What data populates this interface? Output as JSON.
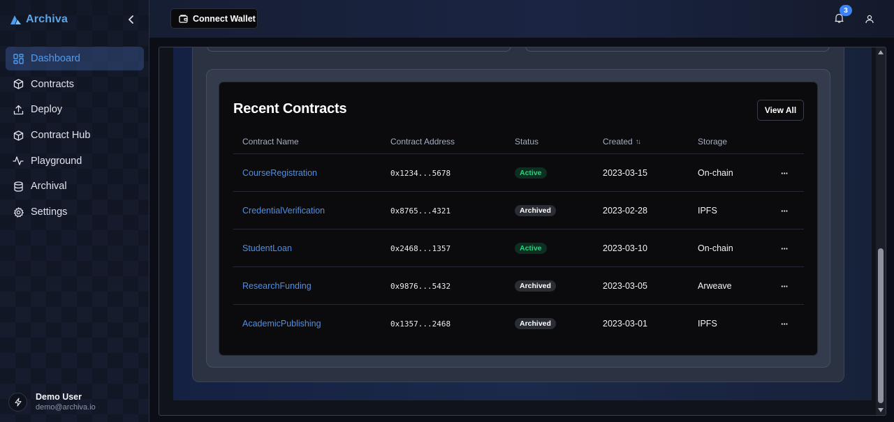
{
  "brand": {
    "name": "Archiva"
  },
  "sidebar": {
    "items": [
      {
        "label": "Dashboard",
        "icon": "dashboard-icon",
        "active": true
      },
      {
        "label": "Contracts",
        "icon": "cube-icon",
        "active": false
      },
      {
        "label": "Deploy",
        "icon": "upload-icon",
        "active": false
      },
      {
        "label": "Contract Hub",
        "icon": "cube-icon",
        "active": false
      },
      {
        "label": "Playground",
        "icon": "activity-icon",
        "active": false
      },
      {
        "label": "Archival",
        "icon": "database-icon",
        "active": false
      },
      {
        "label": "Settings",
        "icon": "gear-icon",
        "active": false
      }
    ],
    "user": {
      "name": "Demo User",
      "email": "demo@archiva.io"
    }
  },
  "topbar": {
    "connect_wallet_label": "Connect Wallet",
    "notification_count": "3"
  },
  "recent_contracts": {
    "title": "Recent Contracts",
    "view_all_label": "View All",
    "columns": [
      "Contract Name",
      "Contract Address",
      "Status",
      "Created",
      "Storage"
    ],
    "sort_indicator": "↑↓",
    "rows": [
      {
        "name": "CourseRegistration",
        "address": "0x1234...5678",
        "status": "Active",
        "created": "2023-03-15",
        "storage": "On-chain"
      },
      {
        "name": "CredentialVerification",
        "address": "0x8765...4321",
        "status": "Archived",
        "created": "2023-02-28",
        "storage": "IPFS"
      },
      {
        "name": "StudentLoan",
        "address": "0x2468...1357",
        "status": "Active",
        "created": "2023-03-10",
        "storage": "On-chain"
      },
      {
        "name": "ResearchFunding",
        "address": "0x9876...5432",
        "status": "Archived",
        "created": "2023-03-05",
        "storage": "Arweave"
      },
      {
        "name": "AcademicPublishing",
        "address": "0x1357...2468",
        "status": "Archived",
        "created": "2023-03-01",
        "storage": "IPFS"
      }
    ],
    "row_menu_glyph": "···"
  },
  "colors": {
    "accent": "#4f9cf0",
    "active_status": "#2fcf7f",
    "link": "#4f8fe6",
    "notification_badge": "#3b82f6"
  }
}
